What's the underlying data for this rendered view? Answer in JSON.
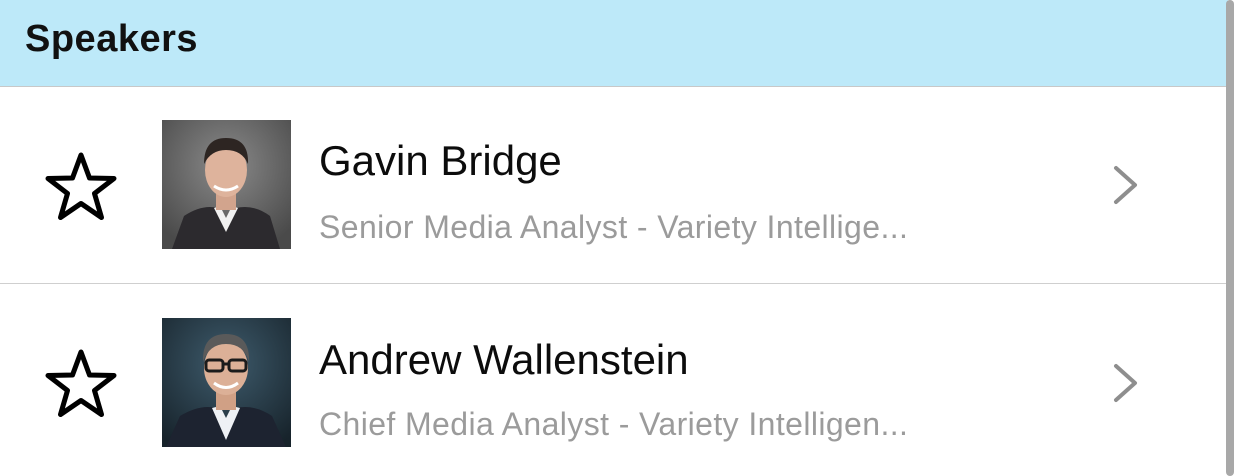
{
  "section": {
    "title": "Speakers"
  },
  "speakers": [
    {
      "name": "Gavin Bridge",
      "title": "Senior Media Analyst - Variety Intellige...",
      "favorite_icon": "star-outline-icon",
      "chevron_icon": "chevron-right-icon"
    },
    {
      "name": "Andrew Wallenstein",
      "title": "Chief Media Analyst - Variety Intelligen...",
      "favorite_icon": "star-outline-icon",
      "chevron_icon": "chevron-right-icon"
    }
  ],
  "colors": {
    "header_background": "#bde9f9",
    "name_text": "#0c0c0c",
    "subtitle_text": "#9b9b9b",
    "chevron": "#8e8e8e",
    "divider": "#cfcfcf"
  }
}
